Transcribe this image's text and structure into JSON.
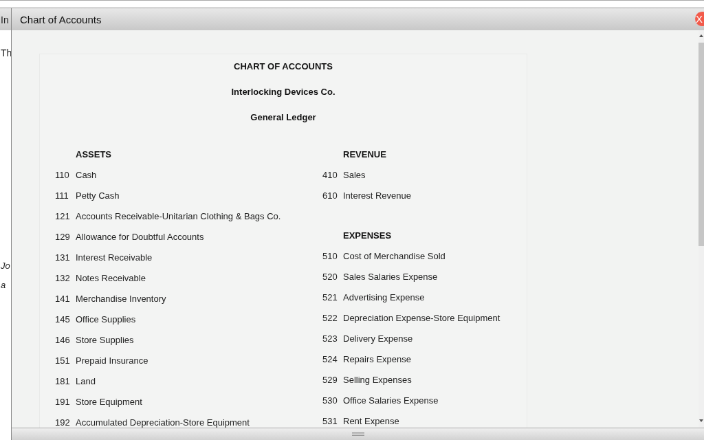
{
  "background_texts": [
    {
      "text": "In",
      "italic": false
    },
    {
      "text": "Th",
      "italic": false
    },
    {
      "text": "Jo",
      "italic": true
    },
    {
      "text": "a",
      "italic": true
    }
  ],
  "window": {
    "title": "Chart of Accounts",
    "close": "X"
  },
  "document": {
    "title": "CHART OF ACCOUNTS",
    "company": "Interlocking Devices Co.",
    "ledger": "General Ledger",
    "columns": [
      [
        {
          "heading": "ASSETS",
          "accounts": [
            {
              "number": "110",
              "name": "Cash"
            },
            {
              "number": "111",
              "name": "Petty Cash"
            },
            {
              "number": "121",
              "name": "Accounts Receivable-Unitarian Clothing & Bags Co."
            },
            {
              "number": "129",
              "name": "Allowance for Doubtful Accounts"
            },
            {
              "number": "131",
              "name": "Interest Receivable"
            },
            {
              "number": "132",
              "name": "Notes Receivable"
            },
            {
              "number": "141",
              "name": "Merchandise Inventory"
            },
            {
              "number": "145",
              "name": "Office Supplies"
            },
            {
              "number": "146",
              "name": "Store Supplies"
            },
            {
              "number": "151",
              "name": "Prepaid Insurance"
            },
            {
              "number": "181",
              "name": "Land"
            },
            {
              "number": "191",
              "name": "Store Equipment"
            },
            {
              "number": "192",
              "name": "Accumulated Depreciation-Store Equipment"
            }
          ]
        }
      ],
      [
        {
          "heading": "REVENUE",
          "accounts": [
            {
              "number": "410",
              "name": "Sales"
            },
            {
              "number": "610",
              "name": "Interest Revenue"
            }
          ]
        },
        {
          "heading": "EXPENSES",
          "accounts": [
            {
              "number": "510",
              "name": "Cost of Merchandise Sold"
            },
            {
              "number": "520",
              "name": "Sales Salaries Expense"
            },
            {
              "number": "521",
              "name": "Advertising Expense"
            },
            {
              "number": "522",
              "name": "Depreciation Expense-Store Equipment"
            },
            {
              "number": "523",
              "name": "Delivery Expense"
            },
            {
              "number": "524",
              "name": "Repairs Expense"
            },
            {
              "number": "529",
              "name": "Selling Expenses"
            },
            {
              "number": "530",
              "name": "Office Salaries Expense"
            },
            {
              "number": "531",
              "name": "Rent Expense"
            }
          ]
        }
      ]
    ]
  }
}
